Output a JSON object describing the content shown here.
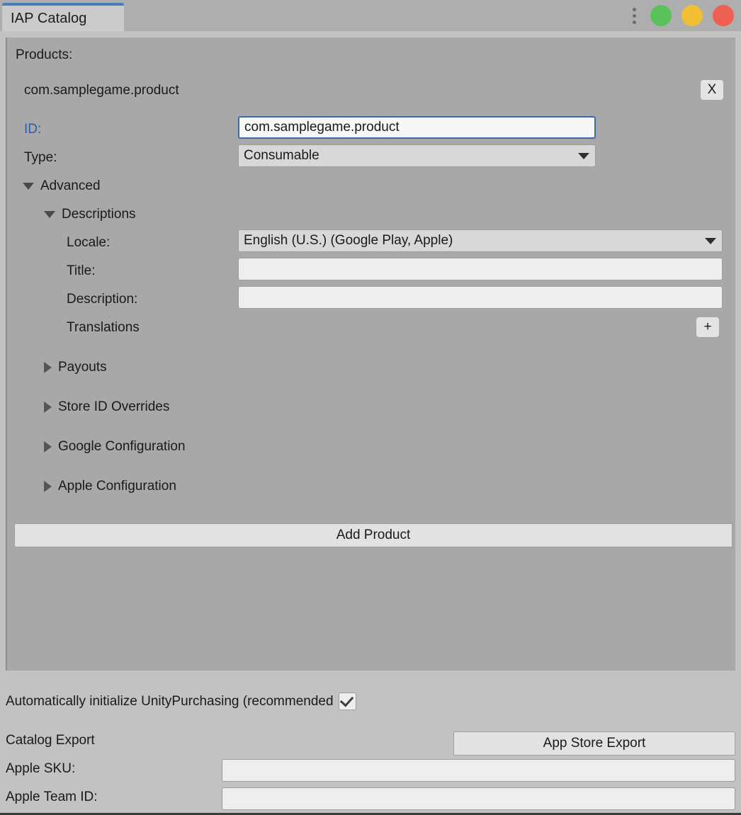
{
  "window": {
    "tab_label": "IAP Catalog",
    "menu_icon": "three-dots-vertical-icon",
    "buttons": {
      "green": "maximize",
      "yellow": "minimize",
      "red": "close"
    },
    "colors": {
      "tab_accent": "#4a7ebb",
      "green": "#5ac05a",
      "yellow": "#f0bf34",
      "red": "#ef5f52",
      "panel_bg": "#a8a8a8",
      "window_bg": "#c2c2c2",
      "label_blue": "#2a5db0"
    }
  },
  "products": {
    "header": "Products:",
    "product_name": "com.samplegame.product",
    "remove_label": "X",
    "id": {
      "label": "ID:",
      "value": "com.samplegame.product",
      "placeholder": ""
    },
    "type": {
      "label": "Type:",
      "value": "Consumable"
    },
    "advanced": {
      "label": "Advanced",
      "expanded": true
    },
    "descriptions": {
      "label": "Descriptions",
      "expanded": true,
      "locale": {
        "label": "Locale:",
        "value": "English (U.S.) (Google Play, Apple)"
      },
      "title": {
        "label": "Title:",
        "value": "",
        "placeholder": ""
      },
      "description": {
        "label": "Description:",
        "value": "",
        "placeholder": ""
      },
      "translations": {
        "label": "Translations",
        "add_label": "+"
      }
    },
    "sections": [
      {
        "label": "Payouts",
        "expanded": false
      },
      {
        "label": "Store ID Overrides",
        "expanded": false
      },
      {
        "label": "Google Configuration",
        "expanded": false
      },
      {
        "label": "Apple Configuration",
        "expanded": false
      }
    ],
    "add_product_label": "Add Product"
  },
  "footer": {
    "auto_init_label": "Automatically initialize UnityPurchasing (recommended",
    "auto_init_checked": true,
    "catalog_export_label": "Catalog Export",
    "app_store_export_label": "App Store Export",
    "apple_sku": {
      "label": "Apple SKU:",
      "value": "",
      "placeholder": ""
    },
    "apple_team_id": {
      "label": "Apple Team ID:",
      "value": "",
      "placeholder": ""
    }
  }
}
